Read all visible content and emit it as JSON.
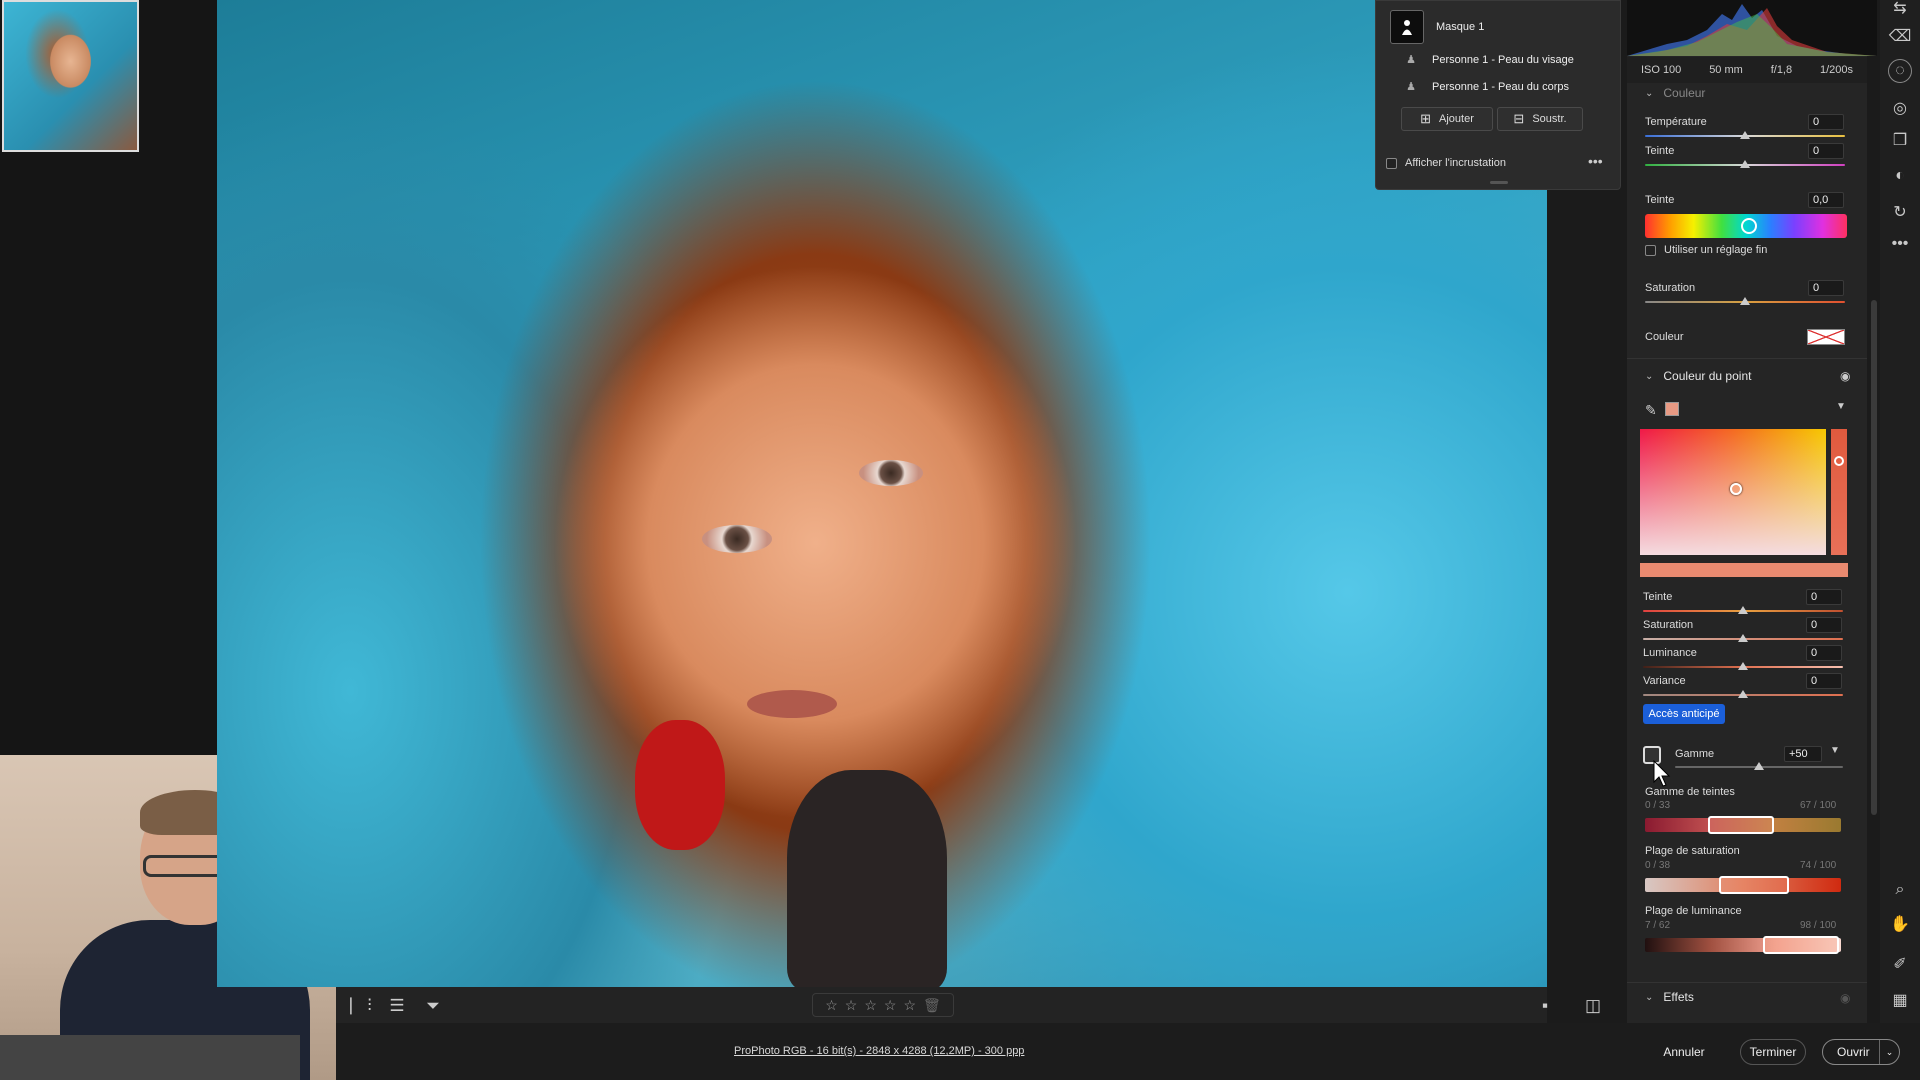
{
  "mask_panel": {
    "mask_name": "Masque 1",
    "components": [
      "Personne 1 - Peau du visage",
      "Personne 1 - Peau du corps"
    ],
    "add_label": "Ajouter",
    "subtract_label": "Soustr.",
    "overlay_label": "Afficher l'incrustation"
  },
  "exif": {
    "iso": "ISO 100",
    "focal": "50 mm",
    "aperture": "f/1,8",
    "shutter": "1/200s"
  },
  "color_section": {
    "title": "Couleur",
    "temperature": {
      "label": "Température",
      "value": "0"
    },
    "tint": {
      "label": "Teinte",
      "value": "0"
    },
    "hue": {
      "label": "Teinte",
      "value": "0,0"
    },
    "fine_adjust_label": "Utiliser un réglage fin",
    "saturation": {
      "label": "Saturation",
      "value": "0"
    },
    "color_label": "Couleur"
  },
  "point_color": {
    "title": "Couleur du point",
    "sliders": [
      {
        "label": "Teinte",
        "value": "0"
      },
      {
        "label": "Saturation",
        "value": "0"
      },
      {
        "label": "Luminance",
        "value": "0"
      },
      {
        "label": "Variance",
        "value": "0"
      }
    ],
    "early_access": "Accès anticipé",
    "range": {
      "label": "Gamme",
      "value": "+50"
    },
    "hue_range": {
      "label": "Gamme de teintes",
      "min": "0 / 33",
      "max": "67 / 100"
    },
    "sat_range": {
      "label": "Plage de saturation",
      "min": "0 / 38",
      "max": "74 / 100"
    },
    "lum_range": {
      "label": "Plage de luminance",
      "min": "7 / 62",
      "max": "98 / 100"
    }
  },
  "effects": {
    "title": "Effets"
  },
  "footer": {
    "file_info": "ProPhoto RGB - 16 bit(s) - 2848 x 4288 (12,2MP) - 300 ppp",
    "cancel": "Annuler",
    "done": "Terminer",
    "open": "Ouvrir"
  },
  "rating": {
    "stars": 0,
    "max": 5
  },
  "colors": {
    "accent": "#1b5fd9",
    "panel_bg": "#252525"
  }
}
